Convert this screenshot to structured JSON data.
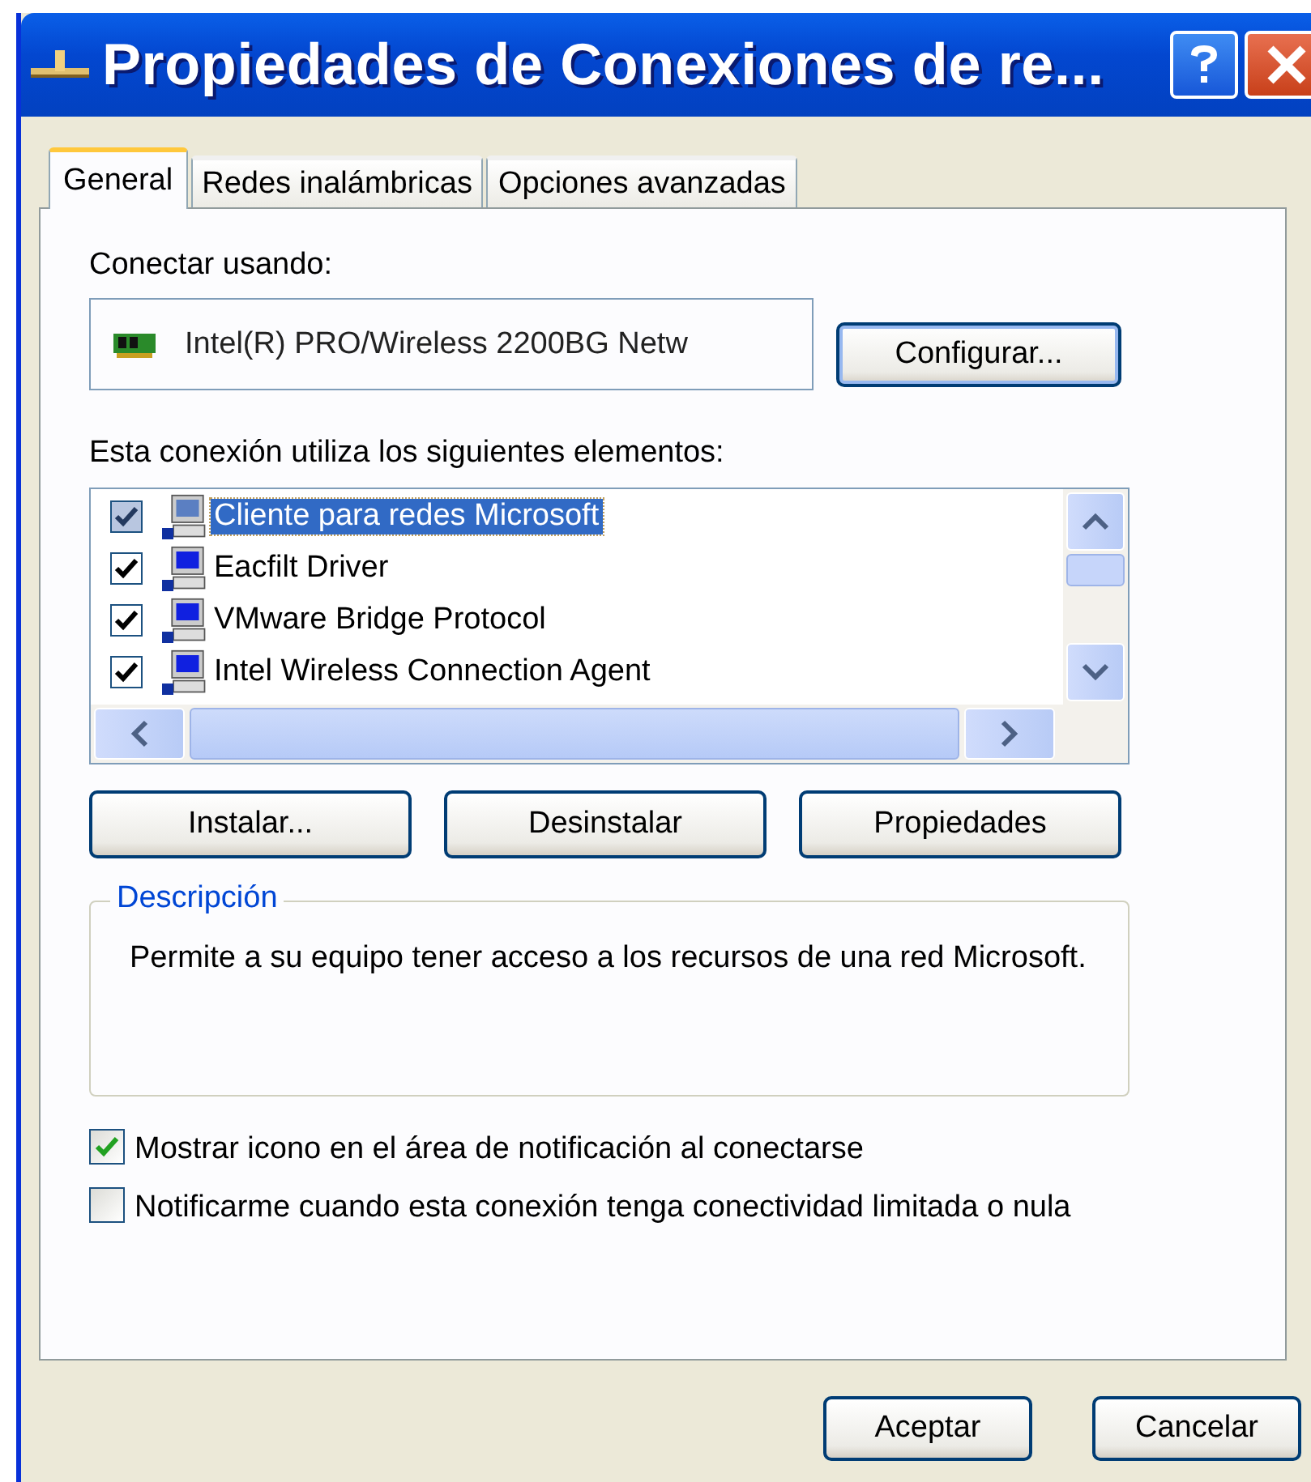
{
  "window": {
    "title": "Propiedades de Conexiones de re..."
  },
  "tabs": [
    {
      "label": "General",
      "selected": true
    },
    {
      "label": "Redes inalámbricas",
      "selected": false
    },
    {
      "label": "Opciones avanzadas",
      "selected": false
    }
  ],
  "connect_using": {
    "label": "Conectar usando:",
    "adapter": "Intel(R) PRO/Wireless 2200BG Netw",
    "configure_button": "Configurar..."
  },
  "components": {
    "label": "Esta conexión utiliza los siguientes elementos:",
    "items": [
      {
        "name": "Cliente para redes Microsoft",
        "checked": true,
        "selected": true
      },
      {
        "name": "Eacfilt Driver",
        "checked": true,
        "selected": false
      },
      {
        "name": "VMware Bridge Protocol",
        "checked": true,
        "selected": false
      },
      {
        "name": "Intel Wireless Connection Agent",
        "checked": true,
        "selected": false
      }
    ]
  },
  "item_buttons": [
    "Instalar...",
    "Desinstalar",
    "Propiedades"
  ],
  "description": {
    "legend": "Descripción",
    "text": "Permite a su equipo tener acceso a los recursos de una red Microsoft."
  },
  "options": [
    {
      "label": "Mostrar icono en el área de notificación al conectarse",
      "checked": true
    },
    {
      "label": "Notificarme cuando esta conexión tenga conectividad limitada o nula",
      "checked": false
    }
  ],
  "buttons": [
    "Aceptar",
    "Cancelar"
  ]
}
